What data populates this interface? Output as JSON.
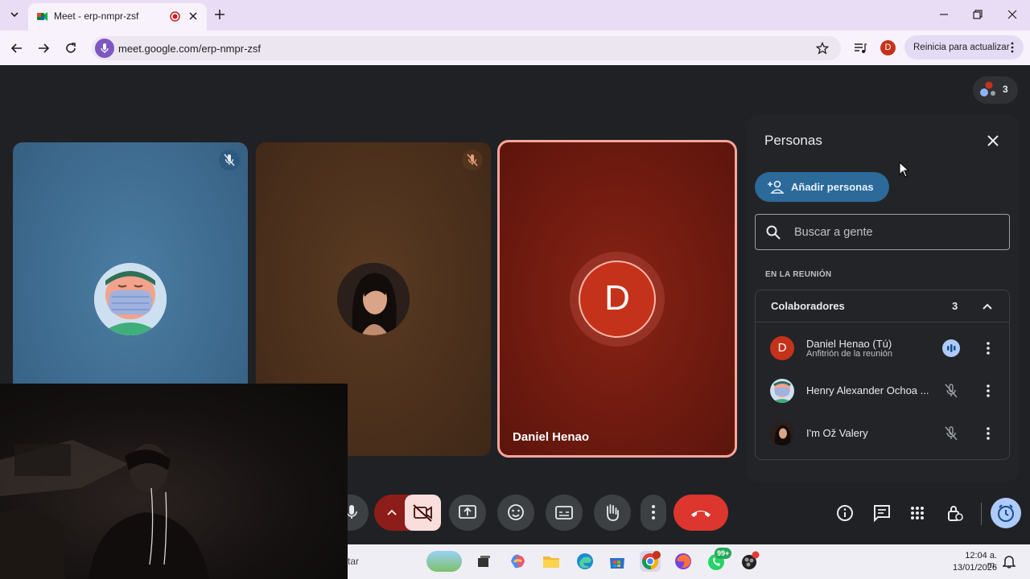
{
  "browser": {
    "tab_title": "Meet - erp-nmpr-zsf",
    "url": "meet.google.com/erp-nmpr-zsf",
    "profile_initial": "D",
    "update_label": "Reinicia para actualizar"
  },
  "meet": {
    "participant_count": "3",
    "tiles": [
      {
        "name": "",
        "muted": true
      },
      {
        "name": "",
        "muted": true
      },
      {
        "name": "Daniel Henao",
        "initial": "D",
        "speaking": true
      }
    ]
  },
  "panel": {
    "title": "Personas",
    "add_label": "Añadir personas",
    "search_placeholder": "Buscar a gente",
    "section_label": "EN LA REUNIÓN",
    "group_title": "Colaboradores",
    "group_count": "3",
    "people": [
      {
        "name": "Daniel Henao (Tú)",
        "subtitle": "Anfitrión de la reunión",
        "initial": "D",
        "mic": "speaking"
      },
      {
        "name": "Henry Alexander Ochoa ...",
        "subtitle": "",
        "mic": "muted"
      },
      {
        "name": "I'm Ož Valery",
        "subtitle": "",
        "mic": "muted"
      }
    ]
  },
  "taskbar": {
    "search_fragment": "tar",
    "time": "12:04 a. m.",
    "date": "13/01/2026",
    "whatsapp_badge": "99+"
  },
  "colors": {
    "accent_blue": "#2b6a99",
    "hangup_red": "#dc362e",
    "speaking_tile_border": "#f7a699"
  }
}
